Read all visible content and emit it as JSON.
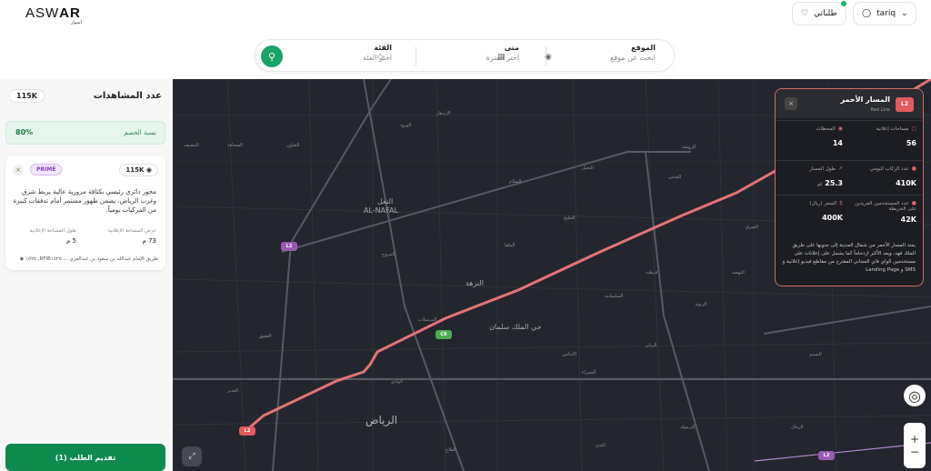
{
  "header": {
    "logo_text_a": "ASW",
    "logo_text_b": "AR",
    "logo_sub": "أسوار",
    "orders_label": "طلباتي",
    "user_name": "tariq"
  },
  "search": {
    "location_label": "الموقع",
    "location_placeholder": "ابحث عن موقع",
    "when_label": "متى",
    "when_placeholder": "اختر الفترة",
    "category_label": "الفئة",
    "category_placeholder": "اختر الفئة"
  },
  "left_panel": {
    "views_title": "عدد المشاهدات",
    "views_value": "115K",
    "discount_label": "نسبة الخصم",
    "discount_value": "80%",
    "card": {
      "badge": "PRIME",
      "views": "115K",
      "description": "محور دائري رئيسي بكثافة مرورية عالية يربط شرق وغرب الرياض، يضمن ظهور مستمر أمام تدفقات كبيرة من المركبات يومياً.",
      "stat1_label": "طول المساحة الإعلانية",
      "stat1_value": "5 م",
      "stat2_label": "عرض المساحة الإعلانية",
      "stat2_value": "73 م",
      "location": "طريق الإمام عبدالله بن سعود بن عبدالعزي..., RFIB١٥٢٥, ١٥٢٥"
    },
    "submit_label": "تقديم الطلب (1)"
  },
  "map": {
    "labels": {
      "riyadh": "الرياض",
      "alnafal": "AL-NAFAL",
      "nafal_ar": "النفل",
      "nuzha": "النزهة",
      "king_salman": "حي الملك سلمان",
      "ring_label": "الرياض",
      "masif": "المصيف",
      "taawun": "التعاون",
      "wurud": "الورود",
      "izdihar": "الازدهار",
      "sahafa": "الصحافة",
      "nakheel": "النخيل",
      "rawdah": "الروضة",
      "sulaimaniyah": "السليمانية",
      "malqa": "الملقا",
      "yarmouk": "اليرموك",
      "hamra": "الحمراء",
      "nahda": "النهضة",
      "rabwa": "الربوة",
      "qurtubah": "قرطبة",
      "andalus": "الأندلس",
      "mursalat": "المرسلات",
      "wadi": "الوادي",
      "ghadir": "الغدير",
      "aqiq": "العقيق",
      "muruj": "المروج",
      "falah": "الفلاح",
      "nada": "الندى",
      "rimal": "الرمال",
      "khaleej": "الخليج",
      "sharq": "الشرق",
      "quds": "القدس",
      "salam": "السلام",
      "nasim": "النسيم",
      "rayan": "الريان"
    },
    "shields": {
      "a": "L2",
      "b": "L2",
      "c": "L2",
      "d": "C6"
    }
  },
  "info": {
    "badge": "L2",
    "title": "المسار الأحمر",
    "subtitle": "Red Line",
    "close_icon": "×",
    "stat_ads_label": "مساحات إعلانية",
    "stat_ads_value": "56",
    "stat_stations_label": "المحطات",
    "stat_stations_value": "14",
    "stat_daily_label": "عدد الركاب اليومي",
    "stat_daily_value": "410K",
    "stat_length_label": "طول المسار",
    "stat_length_value": "25.3",
    "stat_length_unit": "كم",
    "stat_users_label": "عدد المستخدمين الفريدين على الخريطة",
    "stat_users_value": "42K",
    "stat_price_label": "السعر (ريال)",
    "stat_price_value": "400K",
    "description": "يمتد المسار الأحمر من شمال المدينة إلى جنوبها على طريق الملك فهد، ويعد الأكثر ازدحاماً كما يشمل على إعلانات على مستخدمين الواي فاي المجاني المقترح من مقاطع فيديو إعلانية و SMS و Landing Page"
  },
  "colors": {
    "map_bg": "#23262e",
    "route": "#e57373",
    "accent": "#19a463",
    "prime": "#8a3fc1"
  }
}
